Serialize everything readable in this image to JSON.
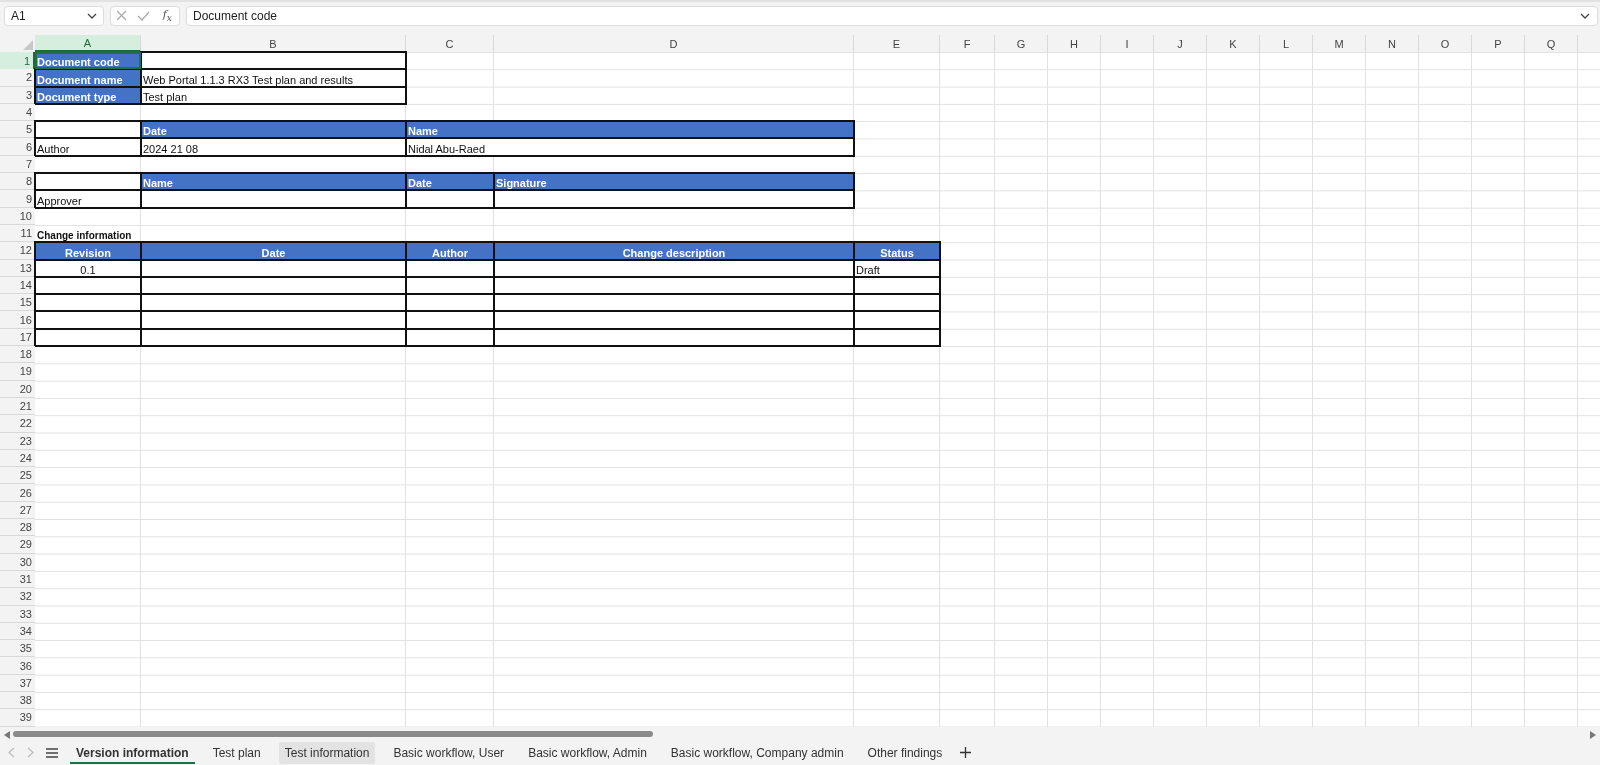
{
  "formula_bar": {
    "name_box": "A1",
    "formula": "Document code",
    "function_button": "f$_{x}$"
  },
  "sheet": {
    "columns": [
      {
        "label": "A",
        "selected": true
      },
      {
        "label": "B",
        "selected": false
      },
      {
        "label": "C",
        "selected": false
      },
      {
        "label": "D",
        "selected": false
      },
      {
        "label": "E",
        "selected": false
      },
      {
        "label": "F",
        "selected": false
      },
      {
        "label": "G",
        "selected": false
      },
      {
        "label": "H",
        "selected": false
      },
      {
        "label": "I",
        "selected": false
      },
      {
        "label": "J",
        "selected": false
      },
      {
        "label": "K",
        "selected": false
      },
      {
        "label": "L",
        "selected": false
      },
      {
        "label": "M",
        "selected": false
      },
      {
        "label": "N",
        "selected": false
      },
      {
        "label": "O",
        "selected": false
      },
      {
        "label": "P",
        "selected": false
      },
      {
        "label": "Q",
        "selected": false
      }
    ],
    "rows": [
      {
        "number": "1",
        "selected": true,
        "cells": [
          {
            "kind": "header",
            "text": "Document code",
            "selected": true
          },
          {
            "kind": "blank",
            "selected": false
          }
        ]
      },
      {
        "number": "2",
        "selected": false,
        "cells": [
          {
            "kind": "header",
            "text": "Document name",
            "selected": false
          },
          {
            "kind": "text",
            "text": "Web Portal 1.1.3 RX3 Test plan and results",
            "selected": false
          }
        ]
      },
      {
        "number": "3",
        "selected": false,
        "cells": [
          {
            "kind": "header",
            "text": "Document type",
            "selected": false
          },
          {
            "kind": "text",
            "text": "Test plan",
            "selected": false
          }
        ]
      },
      {
        "number": "4",
        "selected": false,
        "cells": []
      },
      {
        "number": "5",
        "selected": false,
        "cells": [
          {
            "kind": "blank",
            "selected": false
          },
          {
            "kind": "header",
            "text": "Date",
            "selected": false
          },
          {
            "kind": "header-wide",
            "text": "Name",
            "selected": false
          }
        ]
      },
      {
        "number": "6",
        "selected": false,
        "cells": [
          {
            "kind": "text",
            "text": "Author",
            "selected": false
          },
          {
            "kind": "text",
            "text": "2024 21 08",
            "selected": false
          },
          {
            "kind": "text-wide",
            "text": "Nidal Abu-Raed",
            "selected": false
          }
        ]
      },
      {
        "number": "7",
        "selected": false,
        "cells": []
      },
      {
        "number": "8",
        "selected": false,
        "cells": [
          {
            "kind": "blank",
            "selected": false
          },
          {
            "kind": "header",
            "text": "Name",
            "selected": false
          },
          {
            "kind": "header",
            "text": "Date",
            "selected": false
          },
          {
            "kind": "header",
            "text": "Signature",
            "selected": false
          }
        ]
      },
      {
        "number": "9",
        "selected": false,
        "cells": [
          {
            "kind": "text",
            "text": "Approver",
            "selected": false
          },
          {
            "kind": "blank",
            "selected": false
          },
          {
            "kind": "blank",
            "selected": false
          },
          {
            "kind": "blank",
            "selected": false
          }
        ]
      },
      {
        "number": "10",
        "selected": false,
        "cells": []
      },
      {
        "number": "11",
        "selected": false,
        "cells": [
          {
            "kind": "caption",
            "text": "Change information",
            "selected": false
          }
        ]
      },
      {
        "number": "12",
        "selected": false,
        "cells": [
          {
            "kind": "header-center",
            "text": "Revision",
            "selected": false
          },
          {
            "kind": "header-center",
            "text": "Date",
            "selected": false
          },
          {
            "kind": "header-center",
            "text": "Author",
            "selected": false
          },
          {
            "kind": "header-center",
            "text": "Change description",
            "selected": false
          },
          {
            "kind": "header-center",
            "text": "Status",
            "selected": false
          }
        ]
      },
      {
        "number": "13",
        "selected": false,
        "cells": [
          {
            "kind": "text-center",
            "text": "0.1",
            "selected": false
          },
          {
            "kind": "blank",
            "selected": false
          },
          {
            "kind": "blank",
            "selected": false
          },
          {
            "kind": "blank",
            "selected": false
          },
          {
            "kind": "text",
            "text": "Draft",
            "selected": false
          }
        ]
      },
      {
        "number": "14",
        "selected": false,
        "cells": [
          {
            "kind": "blank",
            "selected": false
          },
          {
            "kind": "blank",
            "selected": false
          },
          {
            "kind": "blank",
            "selected": false
          },
          {
            "kind": "blank",
            "selected": false
          },
          {
            "kind": "blank",
            "selected": false
          }
        ]
      },
      {
        "number": "15",
        "selected": false,
        "cells": [
          {
            "kind": "blank",
            "selected": false
          },
          {
            "kind": "blank",
            "selected": false
          },
          {
            "kind": "blank",
            "selected": false
          },
          {
            "kind": "blank",
            "selected": false
          },
          {
            "kind": "blank",
            "selected": false
          }
        ]
      },
      {
        "number": "16",
        "selected": false,
        "cells": [
          {
            "kind": "blank",
            "selected": false
          },
          {
            "kind": "blank",
            "selected": false
          },
          {
            "kind": "blank",
            "selected": false
          },
          {
            "kind": "blank",
            "selected": false
          },
          {
            "kind": "blank",
            "selected": false
          }
        ]
      },
      {
        "number": "17",
        "selected": false,
        "cells": [
          {
            "kind": "blank",
            "selected": false
          },
          {
            "kind": "blank",
            "selected": false
          },
          {
            "kind": "blank",
            "selected": false
          },
          {
            "kind": "blank",
            "selected": false
          },
          {
            "kind": "blank",
            "selected": false
          }
        ]
      },
      {
        "number": "18",
        "selected": false,
        "cells": []
      },
      {
        "number": "19",
        "selected": false,
        "cells": []
      },
      {
        "number": "20",
        "selected": false,
        "cells": []
      },
      {
        "number": "21",
        "selected": false,
        "cells": []
      },
      {
        "number": "22",
        "selected": false,
        "cells": []
      },
      {
        "number": "23",
        "selected": false,
        "cells": []
      },
      {
        "number": "24",
        "selected": false,
        "cells": []
      },
      {
        "number": "25",
        "selected": false,
        "cells": []
      },
      {
        "number": "26",
        "selected": false,
        "cells": []
      },
      {
        "number": "27",
        "selected": false,
        "cells": []
      },
      {
        "number": "28",
        "selected": false,
        "cells": []
      },
      {
        "number": "29",
        "selected": false,
        "cells": []
      },
      {
        "number": "30",
        "selected": false,
        "cells": []
      },
      {
        "number": "31",
        "selected": false,
        "cells": []
      },
      {
        "number": "32",
        "selected": false,
        "cells": []
      },
      {
        "number": "33",
        "selected": false,
        "cells": []
      },
      {
        "number": "34",
        "selected": false,
        "cells": []
      },
      {
        "number": "35",
        "selected": false,
        "cells": []
      },
      {
        "number": "36",
        "selected": false,
        "cells": []
      },
      {
        "number": "37",
        "selected": false,
        "cells": []
      },
      {
        "number": "38",
        "selected": false,
        "cells": []
      },
      {
        "number": "39",
        "selected": false,
        "cells": []
      }
    ]
  },
  "sheet_tabs": [
    {
      "label": "Version information",
      "selected": true,
      "hovered": false
    },
    {
      "label": "Test plan",
      "selected": false,
      "hovered": false
    },
    {
      "label": "Test information",
      "selected": false,
      "hovered": true
    },
    {
      "label": "Basic workflow, User",
      "selected": false,
      "hovered": false
    },
    {
      "label": "Basic workflow, Admin",
      "selected": false,
      "hovered": false
    },
    {
      "label": "Basic workflow, Company admin",
      "selected": false,
      "hovered": false
    },
    {
      "label": "Other findings",
      "selected": false,
      "hovered": false
    }
  ]
}
